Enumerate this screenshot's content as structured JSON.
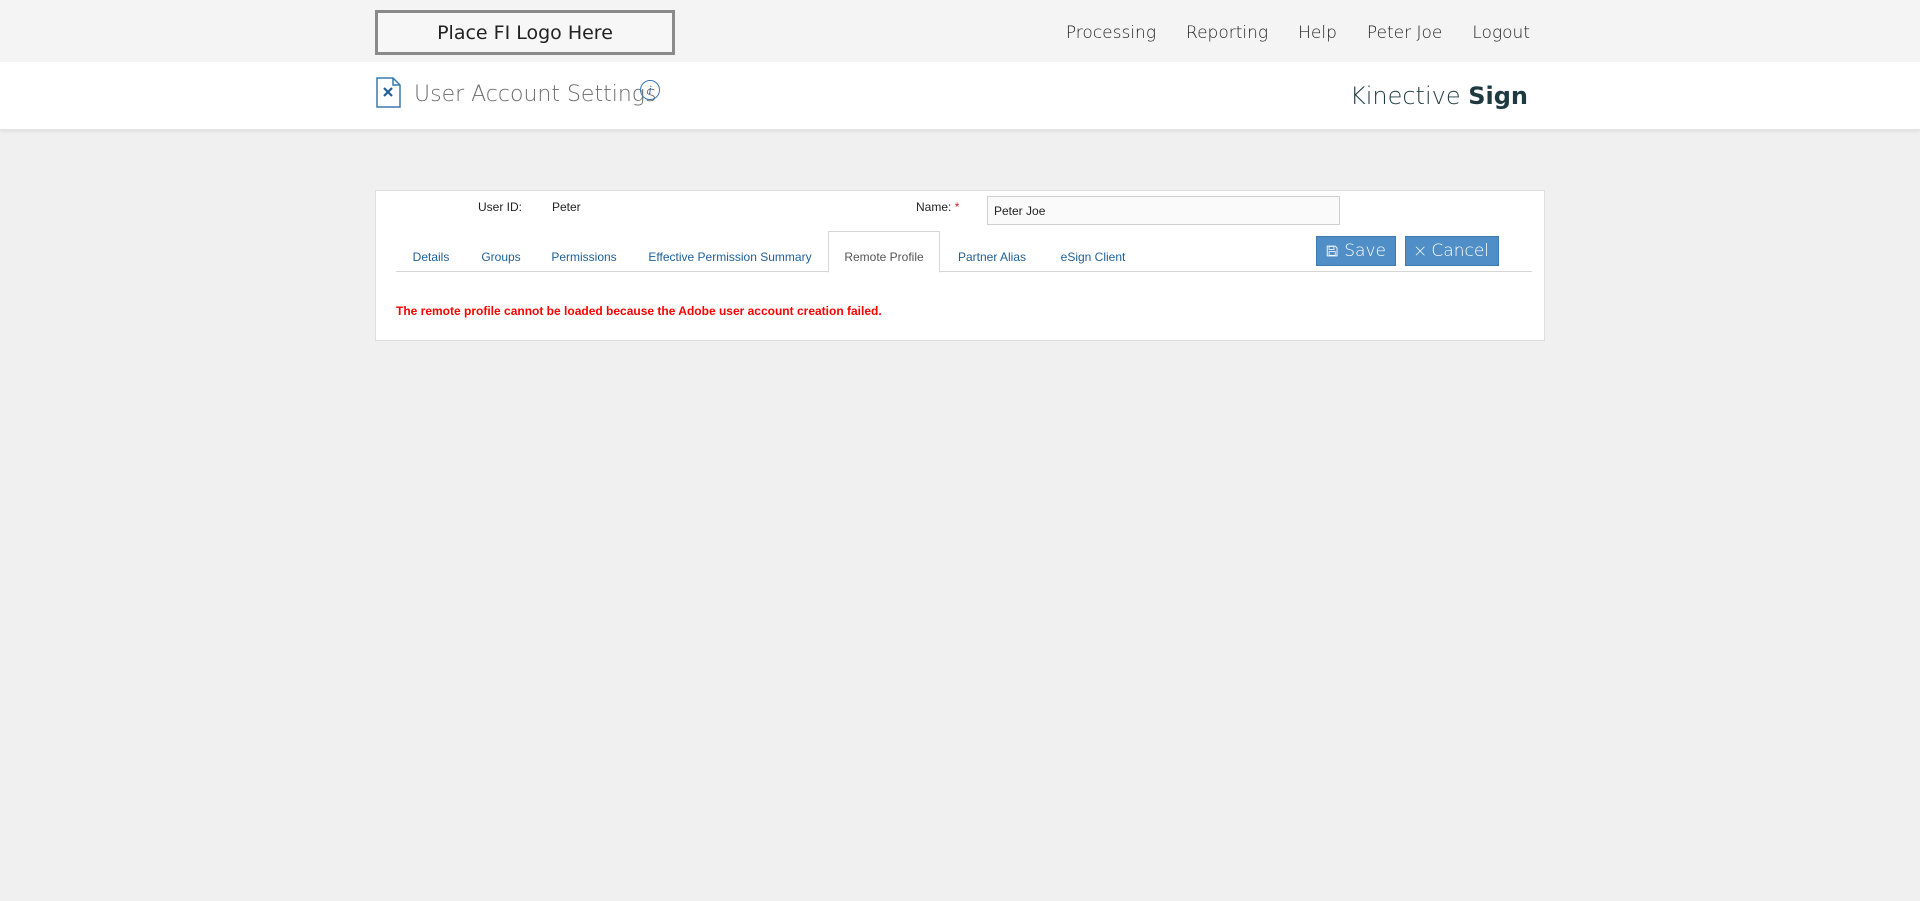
{
  "header": {
    "logo_text": "Place FI Logo Here",
    "nav": [
      "Processing",
      "Reporting",
      "Help",
      "Peter Joe",
      "Logout"
    ]
  },
  "titlebar": {
    "title": "User Account Settings",
    "info_glyph": "i",
    "brand_light": "Kinective",
    "brand_bold": "Sign",
    "icons": [
      "document-icon",
      "info-icon"
    ]
  },
  "form": {
    "user_id_label": "User ID:",
    "user_id_value": "Peter",
    "name_label": "Name:",
    "required_mark": "*",
    "name_value": "Peter Joe"
  },
  "tabs": [
    {
      "label": "Details"
    },
    {
      "label": "Groups"
    },
    {
      "label": "Permissions"
    },
    {
      "label": "Effective Permission Summary"
    },
    {
      "label": "Remote Profile",
      "active": true
    },
    {
      "label": "Partner Alias"
    },
    {
      "label": "eSign Client"
    }
  ],
  "buttons": {
    "save_label": "Save",
    "cancel_label": "Cancel"
  },
  "error_message": "The remote profile cannot be loaded because the Adobe user account creation failed.",
  "colors": {
    "accent": "#4f8ec6",
    "link": "#1f5f96",
    "error": "#ff0000",
    "brand": "#1e3a40"
  }
}
